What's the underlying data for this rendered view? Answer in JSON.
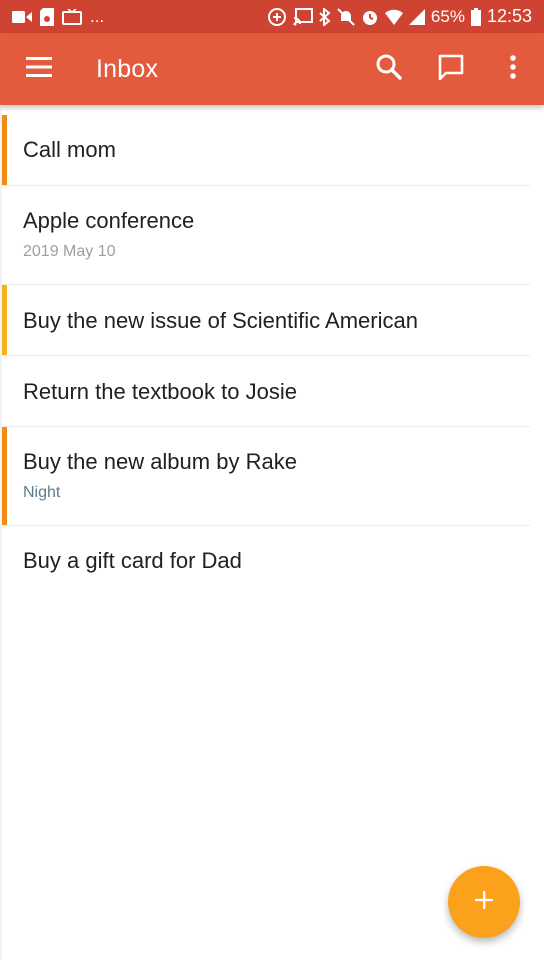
{
  "status_bar": {
    "left_icons": [
      "video-call-icon",
      "storage-card-icon",
      "tv-icon"
    ],
    "left_more": "...",
    "right_icons": [
      "data-saver-icon",
      "cast-icon",
      "bluetooth-icon",
      "mute-icon",
      "alarm-icon",
      "wifi-icon",
      "signal-icon"
    ],
    "battery": "65%",
    "time": "12:53"
  },
  "app_bar": {
    "title": "Inbox",
    "color": "#e35a3d",
    "actions": [
      "search-icon",
      "comment-icon",
      "more-vert-icon"
    ]
  },
  "tasks": [
    {
      "title": "Call mom",
      "subtitle": "",
      "flagged": true,
      "flag_color": "#f08d12"
    },
    {
      "title": "Apple conference",
      "subtitle": "2019 May 10",
      "subtitle_color": "#9e9e9e",
      "flagged": false
    },
    {
      "title": "Buy the new issue of Scientific American",
      "subtitle": "",
      "flagged": true,
      "flag_color": "#f8b21c"
    },
    {
      "title": "Return the textbook to Josie",
      "subtitle": "",
      "flagged": false
    },
    {
      "title": "Buy the new album by Rake",
      "subtitle": "Night",
      "subtitle_color": "#5f7c8a",
      "flagged": true,
      "flag_color": "#f08d12"
    },
    {
      "title": "Buy a gift card for Dad",
      "subtitle": "",
      "flagged": false
    }
  ],
  "fab": {
    "icon": "plus-icon",
    "label": "+",
    "color": "#fba11b"
  }
}
